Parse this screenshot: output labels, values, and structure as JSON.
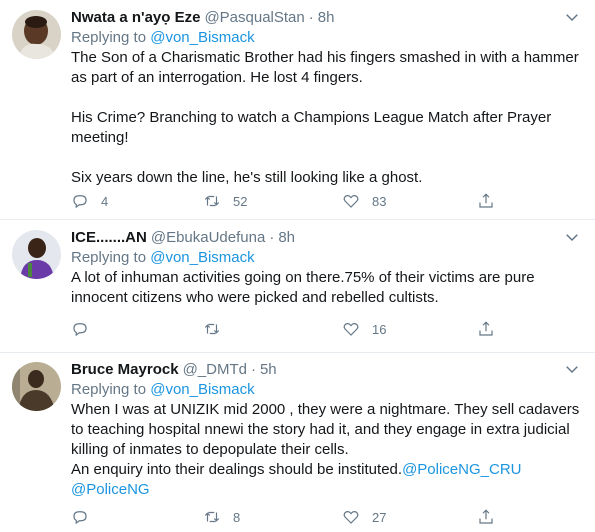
{
  "tweets": [
    {
      "name": "Nwata a n'ayọ Eze",
      "handle": "@PasqualStan",
      "time": "8h",
      "replying_prefix": "Replying to",
      "replying_to": "@von_Bismack",
      "lines": [
        "The Son of a Charismatic Brother had his fingers smashed in with a hammer",
        "as part of an interrogation. He lost 4 fingers.",
        "",
        "His Crime? Branching to watch a Champions League Match after Prayer",
        "meeting!",
        "",
        "Six years down the line, he's still looking like a ghost."
      ],
      "replies": "4",
      "retweets": "52",
      "likes": "83"
    },
    {
      "name": "ICE.......AN",
      "handle": "@EbukaUdefuna",
      "time": "8h",
      "replying_prefix": "Replying to",
      "replying_to": "@von_Bismack",
      "lines": [
        "A lot of inhuman activities going on there.75% of their victims are pure",
        "innocent citizens who were picked and rebelled cultists."
      ],
      "replies": "",
      "retweets": "",
      "likes": "16"
    },
    {
      "name": "Bruce Mayrock",
      "handle": "@_DMTd",
      "time": "5h",
      "replying_prefix": "Replying to",
      "replying_to": "@von_Bismack",
      "lines": [
        "When I was at UNIZIK mid 2000 , they were a nightmare. They sell cadavers",
        "to teaching hospital nnewi the story had it, and they engage in extra judicial",
        "killing of inmates to depopulate their cells.",
        "An enquiry into their dealings should be instituted."
      ],
      "mention_1": "@PoliceNG_CRU",
      "mention_2": "@PoliceNG",
      "replies": "",
      "retweets": "8",
      "likes": "27"
    }
  ],
  "icons": [
    "reply-icon",
    "retweet-icon",
    "like-icon",
    "share-icon",
    "chevron-down-icon"
  ],
  "colors": {
    "link": "#1b95e0",
    "muted": "#657786",
    "divider": "#e6ecf0"
  }
}
